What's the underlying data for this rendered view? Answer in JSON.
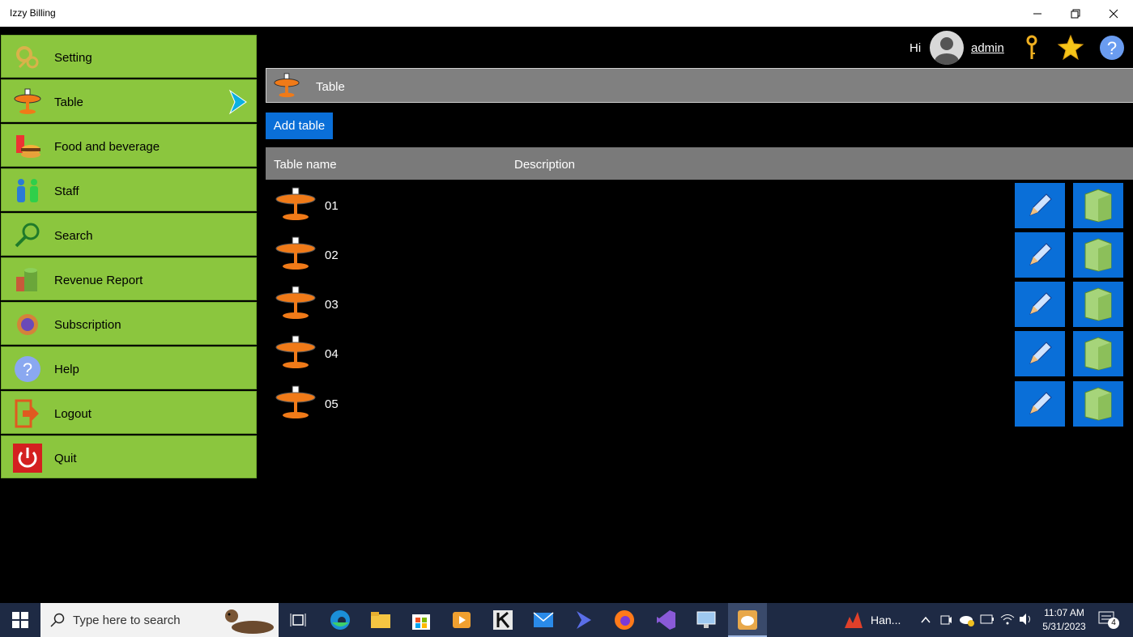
{
  "window": {
    "title": "Izzy Billing"
  },
  "sidebar": {
    "items": [
      {
        "label": "Setting",
        "icon": "gear-key-icon"
      },
      {
        "label": "Table",
        "icon": "table-icon",
        "selected": true
      },
      {
        "label": "Food and beverage",
        "icon": "food-icon"
      },
      {
        "label": "Staff",
        "icon": "staff-icon"
      },
      {
        "label": "Search",
        "icon": "search-icon"
      },
      {
        "label": "Revenue Report",
        "icon": "report-icon"
      },
      {
        "label": "Subscription",
        "icon": "subscription-icon"
      },
      {
        "label": "Help",
        "icon": "help-icon"
      },
      {
        "label": "Logout",
        "icon": "logout-icon"
      },
      {
        "label": "Quit",
        "icon": "power-icon"
      }
    ]
  },
  "header": {
    "greeting": "Hi",
    "username": "admin"
  },
  "section": {
    "title": "Table"
  },
  "actions": {
    "add_label": "Add table"
  },
  "table": {
    "columns": [
      "Table name",
      "Description"
    ],
    "rows": [
      {
        "name": "01",
        "description": ""
      },
      {
        "name": "02",
        "description": ""
      },
      {
        "name": "03",
        "description": ""
      },
      {
        "name": "04",
        "description": ""
      },
      {
        "name": "05",
        "description": ""
      }
    ]
  },
  "taskbar": {
    "search_placeholder": "Type here to search",
    "running_app_label": "Han...",
    "time": "11:07 AM",
    "date": "5/31/2023",
    "notification_count": "4"
  },
  "colors": {
    "nav_green": "#8bc63e",
    "accent_blue": "#0a6fd8",
    "header_gray": "#808080"
  }
}
